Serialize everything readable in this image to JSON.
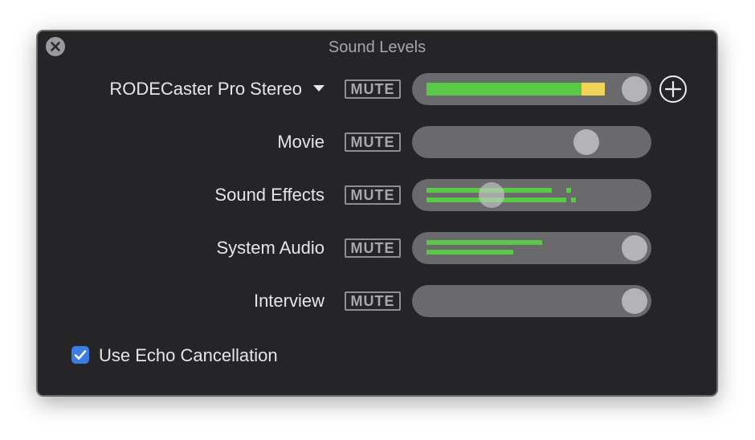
{
  "window": {
    "title": "Sound Levels",
    "close_icon": "close-x-icon"
  },
  "rows": [
    {
      "label": "RODECaster Pro Stereo",
      "is_device_select": true,
      "mute_label": "MUTE",
      "level": 0.93,
      "meter_fraction": 0.75
    },
    {
      "label": "Movie",
      "mute_label": "MUTE",
      "level": 0.73
    },
    {
      "label": "Sound Effects",
      "mute_label": "MUTE",
      "level": 0.33,
      "meter_fraction": 0.6
    },
    {
      "label": "System Audio",
      "mute_label": "MUTE",
      "level": 0.93,
      "meter_fraction": 0.48
    },
    {
      "label": "Interview",
      "mute_label": "MUTE",
      "level": 0.93
    }
  ],
  "add_button_icon": "plus-circle-icon",
  "echo_cancellation": {
    "label": "Use Echo Cancellation",
    "checked": true
  },
  "colors": {
    "window_bg": "#252527",
    "track": "#6a6a6c",
    "meter_green": "#5bc948",
    "meter_yellow": "#f0d458",
    "checkbox_blue": "#3b7de4"
  }
}
